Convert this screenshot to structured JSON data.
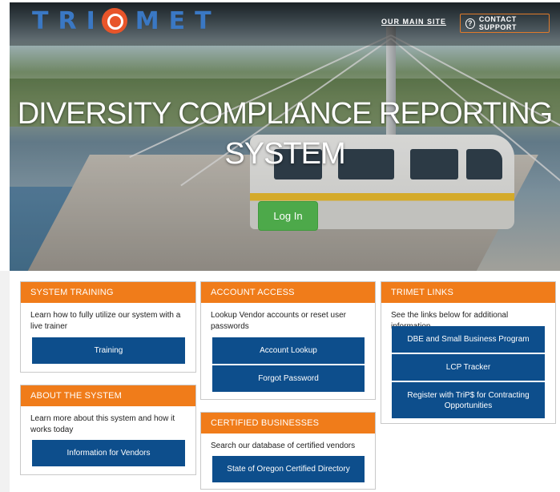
{
  "header": {
    "logo_text_left": "TRI",
    "logo_text_right": "MET",
    "main_site": "OUR MAIN SITE",
    "contact": "CONTACT SUPPORT",
    "contact_icon": "question-circle-icon"
  },
  "hero": {
    "title_line1": "DIVERSITY COMPLIANCE REPORTING",
    "title_line2": "SYSTEM",
    "login": "Log In"
  },
  "cards": {
    "training": {
      "title": "SYSTEM TRAINING",
      "desc": "Learn how to fully utilize our system with a live trainer",
      "button": "Training"
    },
    "about": {
      "title": "ABOUT THE SYSTEM",
      "desc": "Learn more about this system and how it works today",
      "button": "Information for Vendors"
    },
    "account": {
      "title": "ACCOUNT ACCESS",
      "desc": "Lookup Vendor accounts or reset user passwords",
      "button1": "Account Lookup",
      "button2": "Forgot Password"
    },
    "certified": {
      "title": "CERTIFIED BUSINESSES",
      "desc": "Search our database of certified vendors",
      "button": "State of Oregon Certified Directory"
    },
    "links": {
      "title": "TRIMET LINKS",
      "desc": "See the links below for additional information",
      "button1": "DBE and Small Business Program",
      "button2": "LCP Tracker",
      "button3": "Register with TriP$ for Contracting Opportunities"
    }
  },
  "colors": {
    "orange": "#f07c1a",
    "blue": "#0d4e8c",
    "green": "#4da94a",
    "logo_blue": "#3a78c4",
    "logo_orange": "#e8552a"
  }
}
